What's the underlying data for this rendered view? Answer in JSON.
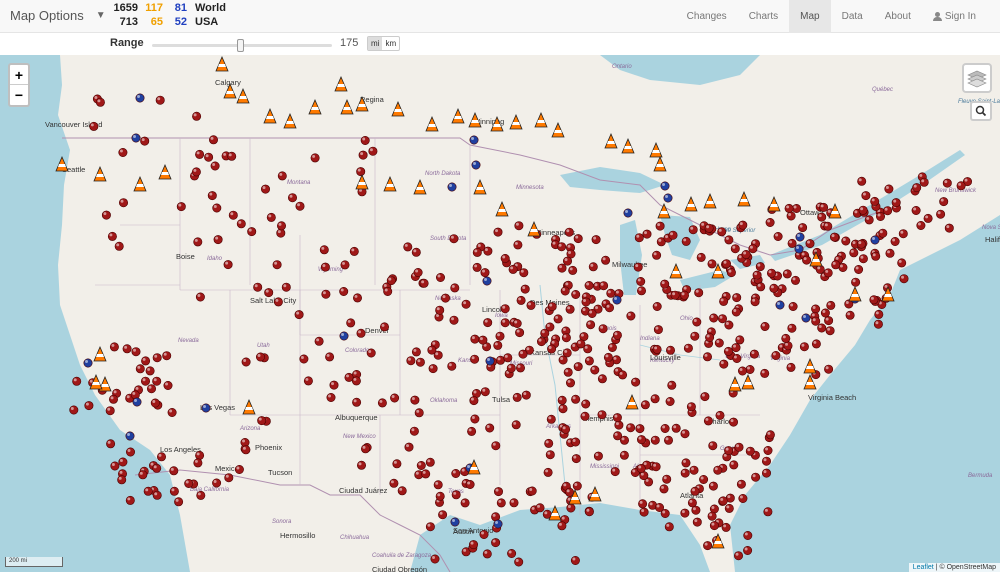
{
  "header": {
    "title": "Map Options",
    "stats": [
      {
        "total": "1659",
        "orange": "117",
        "blue": "81",
        "label": "World"
      },
      {
        "total": "713",
        "orange": "65",
        "blue": "52",
        "label": "USA"
      }
    ],
    "nav": [
      "Changes",
      "Charts",
      "Map",
      "Data",
      "About"
    ],
    "active_nav": "Map",
    "signin": "Sign In"
  },
  "range": {
    "label": "Range",
    "value": "175",
    "fill_fraction": 0.49,
    "units": [
      "mi",
      "km"
    ],
    "active_unit": "mi"
  },
  "map": {
    "zoom_in": "+",
    "zoom_out": "−",
    "scale": "200 mi",
    "attribution_leaflet": "Leaflet",
    "attribution_rest": " | © OpenStreetMap",
    "colors": {
      "red_marker": "#a01818",
      "blue_marker": "#2040a0",
      "cone": "#ff7a00",
      "land": "#f2efe9",
      "water": "#aad3df",
      "border": "#b090b0"
    },
    "labels": [
      {
        "text": "Ontario",
        "kind": "region"
      },
      {
        "text": "Québec",
        "kind": "region"
      },
      {
        "text": "Fleuve Saint-Laurent",
        "kind": "water"
      },
      {
        "text": "New Brunswick",
        "kind": "region"
      },
      {
        "text": "Nova Scotia",
        "kind": "region"
      },
      {
        "text": "Halifax",
        "kind": "city"
      },
      {
        "text": "Vancouver Island",
        "kind": "city"
      },
      {
        "text": "Seattle",
        "kind": "city"
      },
      {
        "text": "Montana",
        "kind": "region"
      },
      {
        "text": "North Dakota",
        "kind": "region"
      },
      {
        "text": "Minnesota",
        "kind": "region"
      },
      {
        "text": "South Dakota",
        "kind": "region"
      },
      {
        "text": "Wyoming",
        "kind": "region"
      },
      {
        "text": "Idaho",
        "kind": "region"
      },
      {
        "text": "Boise",
        "kind": "city"
      },
      {
        "text": "Nebraska",
        "kind": "region"
      },
      {
        "text": "Iowa",
        "kind": "region"
      },
      {
        "text": "Des Moines",
        "kind": "city"
      },
      {
        "text": "Lincoln",
        "kind": "city"
      },
      {
        "text": "Nevada",
        "kind": "region"
      },
      {
        "text": "Utah",
        "kind": "region"
      },
      {
        "text": "Colorado",
        "kind": "region"
      },
      {
        "text": "Kansas",
        "kind": "region"
      },
      {
        "text": "Missouri",
        "kind": "region"
      },
      {
        "text": "Illinois",
        "kind": "region"
      },
      {
        "text": "Indiana",
        "kind": "region"
      },
      {
        "text": "Ohio",
        "kind": "region"
      },
      {
        "text": "Kentucky",
        "kind": "region"
      },
      {
        "text": "West Virginia",
        "kind": "region"
      },
      {
        "text": "Virginia",
        "kind": "region"
      },
      {
        "text": "Virginia Beach",
        "kind": "city"
      },
      {
        "text": "Milwaukee",
        "kind": "city"
      },
      {
        "text": "Minneapolis",
        "kind": "city"
      },
      {
        "text": "Louisville",
        "kind": "city"
      },
      {
        "text": "Memphis",
        "kind": "city"
      },
      {
        "text": "Tulsa",
        "kind": "city"
      },
      {
        "text": "Arkansas",
        "kind": "region"
      },
      {
        "text": "Oklahoma",
        "kind": "region"
      },
      {
        "text": "New Mexico",
        "kind": "region"
      },
      {
        "text": "Albuquerque",
        "kind": "city"
      },
      {
        "text": "Arizona",
        "kind": "region"
      },
      {
        "text": "Phoenix",
        "kind": "city"
      },
      {
        "text": "Tucson",
        "kind": "city"
      },
      {
        "text": "Mexicali",
        "kind": "city"
      },
      {
        "text": "Baja California",
        "kind": "region"
      },
      {
        "text": "Sonora",
        "kind": "region"
      },
      {
        "text": "Hermosillo",
        "kind": "city"
      },
      {
        "text": "Chihuahua",
        "kind": "region"
      },
      {
        "text": "Ciudad Juárez",
        "kind": "city"
      },
      {
        "text": "Coahuila de Zaragoza",
        "kind": "region"
      },
      {
        "text": "Ciudad Obregón",
        "kind": "city"
      },
      {
        "text": "Texas",
        "kind": "region"
      },
      {
        "text": "Austin",
        "kind": "city"
      },
      {
        "text": "San Antonio",
        "kind": "city"
      },
      {
        "text": "Mississippi",
        "kind": "region"
      },
      {
        "text": "Alabama",
        "kind": "region"
      },
      {
        "text": "Atlanta",
        "kind": "city"
      },
      {
        "text": "Georgia",
        "kind": "region"
      },
      {
        "text": "Charlotte",
        "kind": "city"
      },
      {
        "text": "Bermuda",
        "kind": "region"
      },
      {
        "text": "Los Angeles",
        "kind": "city"
      },
      {
        "text": "Las Vegas",
        "kind": "city"
      },
      {
        "text": "Kansas City",
        "kind": "city"
      },
      {
        "text": "Regina",
        "kind": "city"
      },
      {
        "text": "Winnipeg",
        "kind": "city"
      },
      {
        "text": "Calgary",
        "kind": "city"
      },
      {
        "text": "Ottawa",
        "kind": "city"
      },
      {
        "text": "Lake Superior",
        "kind": "water"
      },
      {
        "text": "Lake Huron",
        "kind": "water"
      },
      {
        "text": "Salt Lake City",
        "kind": "city"
      },
      {
        "text": "Denver",
        "kind": "city"
      }
    ]
  }
}
